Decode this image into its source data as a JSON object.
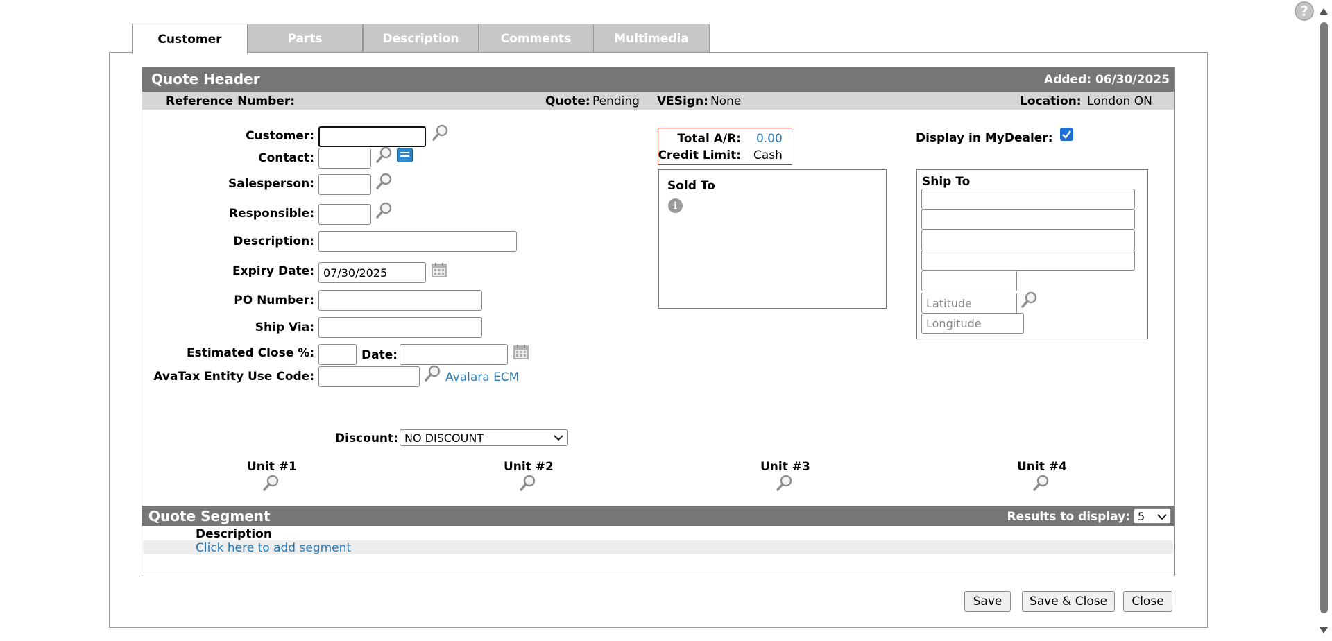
{
  "tabs": [
    {
      "label": "Customer",
      "active": true
    },
    {
      "label": "Parts",
      "active": false
    },
    {
      "label": "Description",
      "active": false
    },
    {
      "label": "Comments",
      "active": false
    },
    {
      "label": "Multimedia",
      "active": false
    }
  ],
  "header": {
    "title": "Quote Header",
    "added": "Added: 06/30/2025",
    "reference_label": "Reference Number:",
    "quote_label": "Quote:",
    "quote_value": "Pending",
    "vesign_label": "VESign:",
    "vesign_value": "None",
    "location_label": "Location:",
    "location_value": "London ON"
  },
  "form": {
    "customer_label": "Customer:",
    "contact_label": "Contact:",
    "salesperson_label": "Salesperson:",
    "responsible_label": "Responsible:",
    "description_label": "Description:",
    "expiry_label": "Expiry Date:",
    "expiry_value": "07/30/2025",
    "po_label": "PO Number:",
    "shipvia_label": "Ship Via:",
    "close_pct_label": "Estimated Close %:",
    "date_label": "Date:",
    "avatax_label": "AvaTax Entity Use Code:",
    "avalara_link": "Avalara ECM",
    "discount_label": "Discount:",
    "discount_value": "NO DISCOUNT"
  },
  "credit": {
    "total_ar_label": "Total A/R:",
    "total_ar_value": "0.00",
    "credit_limit_label": "Credit Limit:",
    "credit_limit_value": "Cash"
  },
  "mydealer": {
    "label": "Display in MyDealer:",
    "checked": true
  },
  "sold_to": {
    "title": "Sold To"
  },
  "ship_to": {
    "title": "Ship To",
    "latitude_placeholder": "Latitude",
    "longitude_placeholder": "Longitude"
  },
  "units": [
    "Unit #1",
    "Unit #2",
    "Unit #3",
    "Unit #4"
  ],
  "segment": {
    "title": "Quote Segment",
    "results_label": "Results to display:",
    "results_value": "5",
    "column_description": "Description",
    "add_link": "Click here to add segment"
  },
  "buttons": {
    "save": "Save",
    "save_close": "Save & Close",
    "close": "Close"
  },
  "colors": {
    "accent": "#2a7ab8",
    "header_bar": "#767676",
    "sub_bar": "#d6d6d6",
    "highlight_border": "#e02020"
  }
}
